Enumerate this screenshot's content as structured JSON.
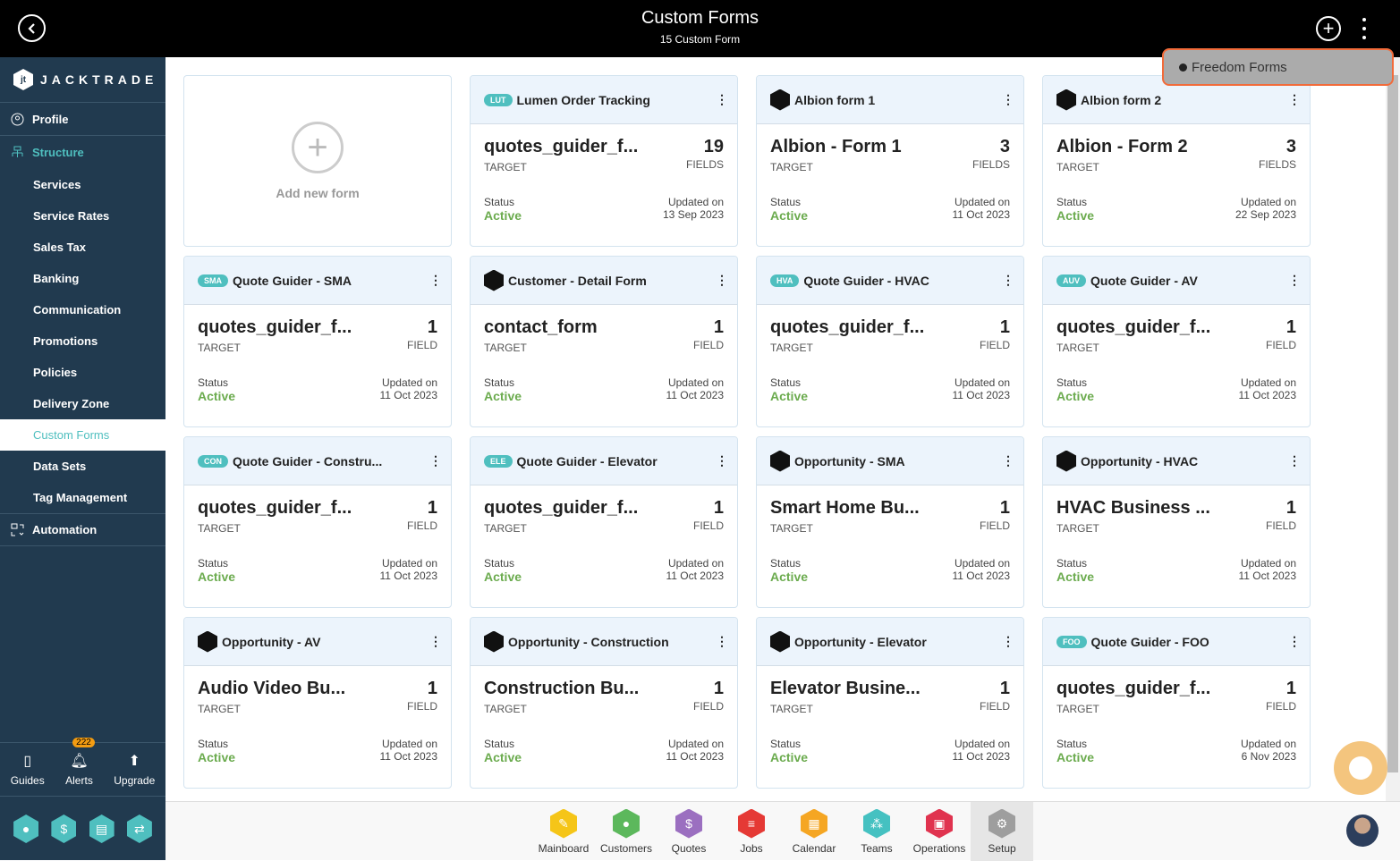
{
  "header": {
    "title": "Custom Forms",
    "subtitle": "15 Custom Form"
  },
  "dropdown": {
    "item": "Freedom Forms"
  },
  "sidebar": {
    "brand": "JACKTRADE",
    "profile": "Profile",
    "structure": "Structure",
    "items": [
      "Services",
      "Service Rates",
      "Sales Tax",
      "Banking",
      "Communication",
      "Promotions",
      "Policies",
      "Delivery Zone",
      "Custom Forms",
      "Data Sets",
      "Tag Management"
    ],
    "active": "Custom Forms",
    "automation": "Automation",
    "tools": {
      "guides": "Guides",
      "alerts": "Alerts",
      "alerts_count": "222",
      "upgrade": "Upgrade"
    }
  },
  "add_card": {
    "label": "Add new form"
  },
  "labels": {
    "target": "TARGET",
    "status": "Status",
    "updated": "Updated on"
  },
  "cards": [
    {
      "tag": "LUT",
      "name": "Lumen Order Tracking",
      "target": "quotes_guider_f...",
      "count": "19",
      "count_label": "FIELDS",
      "status": "Active",
      "updated": "13 Sep 2023"
    },
    {
      "tag": "",
      "name": "Albion form 1",
      "target": "Albion - Form 1",
      "count": "3",
      "count_label": "FIELDS",
      "status": "Active",
      "updated": "11 Oct 2023"
    },
    {
      "tag": "",
      "name": "Albion form 2",
      "target": "Albion - Form 2",
      "count": "3",
      "count_label": "FIELDS",
      "status": "Active",
      "updated": "22 Sep 2023"
    },
    {
      "tag": "SMA",
      "name": "Quote Guider - SMA",
      "target": "quotes_guider_f...",
      "count": "1",
      "count_label": "FIELD",
      "status": "Active",
      "updated": "11 Oct 2023"
    },
    {
      "tag": "",
      "name": "Customer - Detail Form",
      "target": "contact_form",
      "count": "1",
      "count_label": "FIELD",
      "status": "Active",
      "updated": "11 Oct 2023"
    },
    {
      "tag": "HVA",
      "name": "Quote Guider - HVAC",
      "target": "quotes_guider_f...",
      "count": "1",
      "count_label": "FIELD",
      "status": "Active",
      "updated": "11 Oct 2023"
    },
    {
      "tag": "AUV",
      "name": "Quote Guider - AV",
      "target": "quotes_guider_f...",
      "count": "1",
      "count_label": "FIELD",
      "status": "Active",
      "updated": "11 Oct 2023"
    },
    {
      "tag": "CON",
      "name": "Quote Guider - Constru...",
      "target": "quotes_guider_f...",
      "count": "1",
      "count_label": "FIELD",
      "status": "Active",
      "updated": "11 Oct 2023"
    },
    {
      "tag": "ELE",
      "name": "Quote Guider - Elevator",
      "target": "quotes_guider_f...",
      "count": "1",
      "count_label": "FIELD",
      "status": "Active",
      "updated": "11 Oct 2023"
    },
    {
      "tag": "",
      "name": "Opportunity - SMA",
      "target": "Smart Home Bu...",
      "count": "1",
      "count_label": "FIELD",
      "status": "Active",
      "updated": "11 Oct 2023"
    },
    {
      "tag": "",
      "name": "Opportunity - HVAC",
      "target": "HVAC Business ...",
      "count": "1",
      "count_label": "FIELD",
      "status": "Active",
      "updated": "11 Oct 2023"
    },
    {
      "tag": "",
      "name": "Opportunity - AV",
      "target": "Audio Video Bu...",
      "count": "1",
      "count_label": "FIELD",
      "status": "Active",
      "updated": "11 Oct 2023"
    },
    {
      "tag": "",
      "name": "Opportunity - Construction",
      "target": "Construction Bu...",
      "count": "1",
      "count_label": "FIELD",
      "status": "Active",
      "updated": "11 Oct 2023"
    },
    {
      "tag": "",
      "name": "Opportunity - Elevator",
      "target": "Elevator Busine...",
      "count": "1",
      "count_label": "FIELD",
      "status": "Active",
      "updated": "11 Oct 2023"
    },
    {
      "tag": "FOO",
      "name": "Quote Guider - FOO",
      "target": "quotes_guider_f...",
      "count": "1",
      "count_label": "FIELD",
      "status": "Active",
      "updated": "6 Nov 2023"
    }
  ],
  "appnav": [
    {
      "label": "Mainboard",
      "color": "#f5c518",
      "icon": "✎"
    },
    {
      "label": "Customers",
      "color": "#5cb85c",
      "icon": "●"
    },
    {
      "label": "Quotes",
      "color": "#9b6fc0",
      "icon": "$"
    },
    {
      "label": "Jobs",
      "color": "#e53935",
      "icon": "≡"
    },
    {
      "label": "Calendar",
      "color": "#f5a623",
      "icon": "▦"
    },
    {
      "label": "Teams",
      "color": "#45c1c1",
      "icon": "⁂"
    },
    {
      "label": "Operations",
      "color": "#e0334f",
      "icon": "▣"
    },
    {
      "label": "Setup",
      "color": "#9e9e9e",
      "icon": "⚙"
    }
  ],
  "active_app": "Setup"
}
